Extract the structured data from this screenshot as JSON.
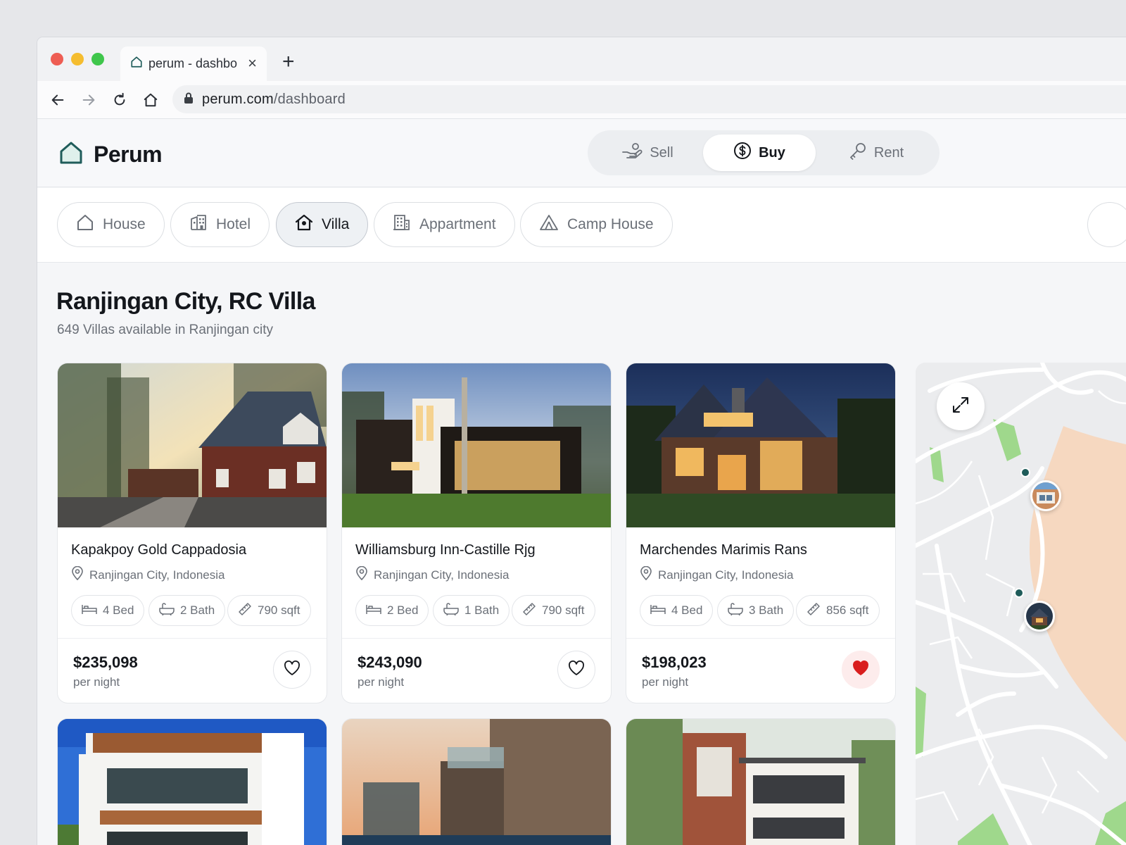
{
  "browser": {
    "tab_title": "perum - dashbo",
    "url_host": "perum.com",
    "url_path": "/dashboard"
  },
  "brand": {
    "name": "Perum",
    "accent": "#1f5c5a"
  },
  "modes": [
    {
      "label": "Sell",
      "icon": "hand-coin-icon",
      "active": false
    },
    {
      "label": "Buy",
      "icon": "dollar-circle-icon",
      "active": true
    },
    {
      "label": "Rent",
      "icon": "key-icon",
      "active": false
    }
  ],
  "categories": [
    {
      "label": "House",
      "icon": "house-icon",
      "active": false
    },
    {
      "label": "Hotel",
      "icon": "hotel-icon",
      "active": false
    },
    {
      "label": "Villa",
      "icon": "villa-icon",
      "active": true
    },
    {
      "label": "Appartment",
      "icon": "apartment-icon",
      "active": false
    },
    {
      "label": "Camp House",
      "icon": "tent-icon",
      "active": false
    }
  ],
  "page": {
    "title": "Ranjingan City, RC Villa",
    "subtitle": "649 Villas available in Ranjingan city"
  },
  "listings": [
    {
      "title": "Kapakpoy Gold Cappadosia",
      "location": "Ranjingan City, Indonesia",
      "bed": "4 Bed",
      "bath": "2 Bath",
      "area": "790 sqft",
      "price": "$235,098",
      "period": "per night",
      "favorite": false
    },
    {
      "title": "Williamsburg Inn-Castille Rjg",
      "location": "Ranjingan City, Indonesia",
      "bed": "2 Bed",
      "bath": "1 Bath",
      "area": "790 sqft",
      "price": "$243,090",
      "period": "per night",
      "favorite": false
    },
    {
      "title": "Marchendes Marimis Rans",
      "location": "Ranjingan City, Indonesia",
      "bed": "4 Bed",
      "bath": "3 Bath",
      "area": "856 sqft",
      "price": "$198,023",
      "period": "per night",
      "favorite": true
    }
  ],
  "colors": {
    "favorite_red": "#d91e1e",
    "map_sand": "#f6d8c0",
    "map_green": "#9fd88c"
  }
}
